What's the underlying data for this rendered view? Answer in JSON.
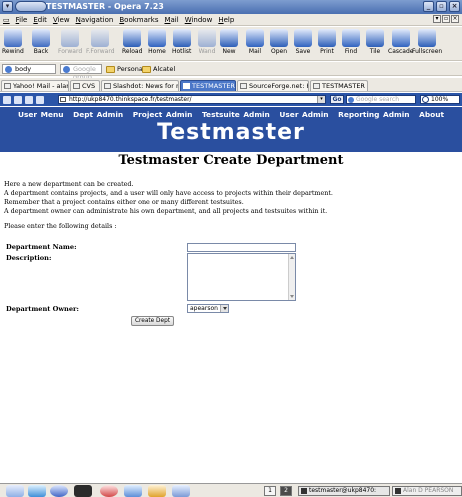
{
  "window": {
    "title": "TESTMASTER - Opera 7.23"
  },
  "menu": [
    "File",
    "Edit",
    "View",
    "Navigation",
    "Bookmarks",
    "Mail",
    "Window",
    "Help"
  ],
  "toolbar": [
    {
      "label": "Rewind",
      "icon": "rewind-icon",
      "enabled": true,
      "color": "#3f6bc1"
    },
    {
      "label": "Back",
      "icon": "back-icon",
      "enabled": true,
      "color": "#3f6bc1"
    },
    {
      "label": "Forward",
      "icon": "forward-icon",
      "enabled": false,
      "color": "#3f6bc1"
    },
    {
      "label": "F.Forward",
      "icon": "fast-forward-icon",
      "enabled": false,
      "color": "#3f6bc1"
    },
    {
      "label": "Reload",
      "icon": "reload-icon",
      "enabled": true,
      "color": "#2d5fb8"
    },
    {
      "label": "Home",
      "icon": "home-icon",
      "enabled": true,
      "color": "#3063c0"
    },
    {
      "label": "Hotlist",
      "icon": "hotlist-icon",
      "enabled": true,
      "color": "#2d5fb8"
    },
    {
      "label": "Wand",
      "icon": "wand-icon",
      "enabled": false,
      "color": "#3f6bc1"
    },
    {
      "label": "New",
      "icon": "new-page-icon",
      "enabled": true,
      "color": "#2d5fb8"
    },
    {
      "label": "Mail",
      "icon": "mail-icon",
      "enabled": true,
      "color": "#3063c0"
    },
    {
      "label": "Open",
      "icon": "open-folder-icon",
      "enabled": true,
      "color": "#2d5fb8"
    },
    {
      "label": "Save",
      "icon": "save-icon",
      "enabled": true,
      "color": "#3063c0"
    },
    {
      "label": "Print",
      "icon": "print-icon",
      "enabled": true,
      "color": "#2d5fb8"
    },
    {
      "label": "Find",
      "icon": "find-icon",
      "enabled": true,
      "color": "#3063c0"
    },
    {
      "label": "Tile",
      "icon": "tile-icon",
      "enabled": true,
      "color": "#2d5fb8"
    },
    {
      "label": "Cascade",
      "icon": "cascade-icon",
      "enabled": true,
      "color": "#3063c0"
    },
    {
      "label": "Fullscreen",
      "icon": "fullscreen-icon",
      "enabled": true,
      "color": "#2d5fb8"
    }
  ],
  "personalbar": {
    "field1": "body",
    "field2": "Google group",
    "folders": [
      "Personal",
      "Alcatel"
    ]
  },
  "tabs": [
    {
      "label": "Yahoo! Mail - alandp...",
      "active": false
    },
    {
      "label": "CVS",
      "active": false
    },
    {
      "label": "Slashdot: News for n...",
      "active": false
    },
    {
      "label": "TESTMASTER",
      "active": true
    },
    {
      "label": "SourceForge.net: H1...",
      "active": false
    },
    {
      "label": "TESTMASTER",
      "active": false
    }
  ],
  "address": {
    "url": "http://ukp8470.thinkspace.fr/testmaster/",
    "go": "Go",
    "search_placeholder": "Google search",
    "zoom": "100%"
  },
  "site": {
    "nav": [
      "User Menu",
      "Dept Admin",
      "Project Admin",
      "Testsuite Admin",
      "User Admin",
      "Reporting Admin",
      "About"
    ],
    "brand": "Testmaster",
    "nav_color": "#2a4f9f"
  },
  "form": {
    "title": "Testmaster Create Department",
    "intro": [
      "Here a new department can be created.",
      "A department contains projects, and a user will only have access to projects within their department.",
      "Remember that a project contains either one or many different testsuites.",
      "A department owner can administrate his own department, and all projects and testsuites within it."
    ],
    "prompt": "Please enter the following details :",
    "name_label": "Department Name:",
    "name_value": "",
    "desc_label": "Description:",
    "desc_value": "",
    "owner_label": "Department Owner:",
    "owner_value": "apearson",
    "submit": "Create Dept"
  },
  "taskbar": {
    "workspaces": [
      "1",
      "2"
    ],
    "items": [
      "testmaster@ukp8470:",
      "Alan D PEARSON"
    ]
  }
}
